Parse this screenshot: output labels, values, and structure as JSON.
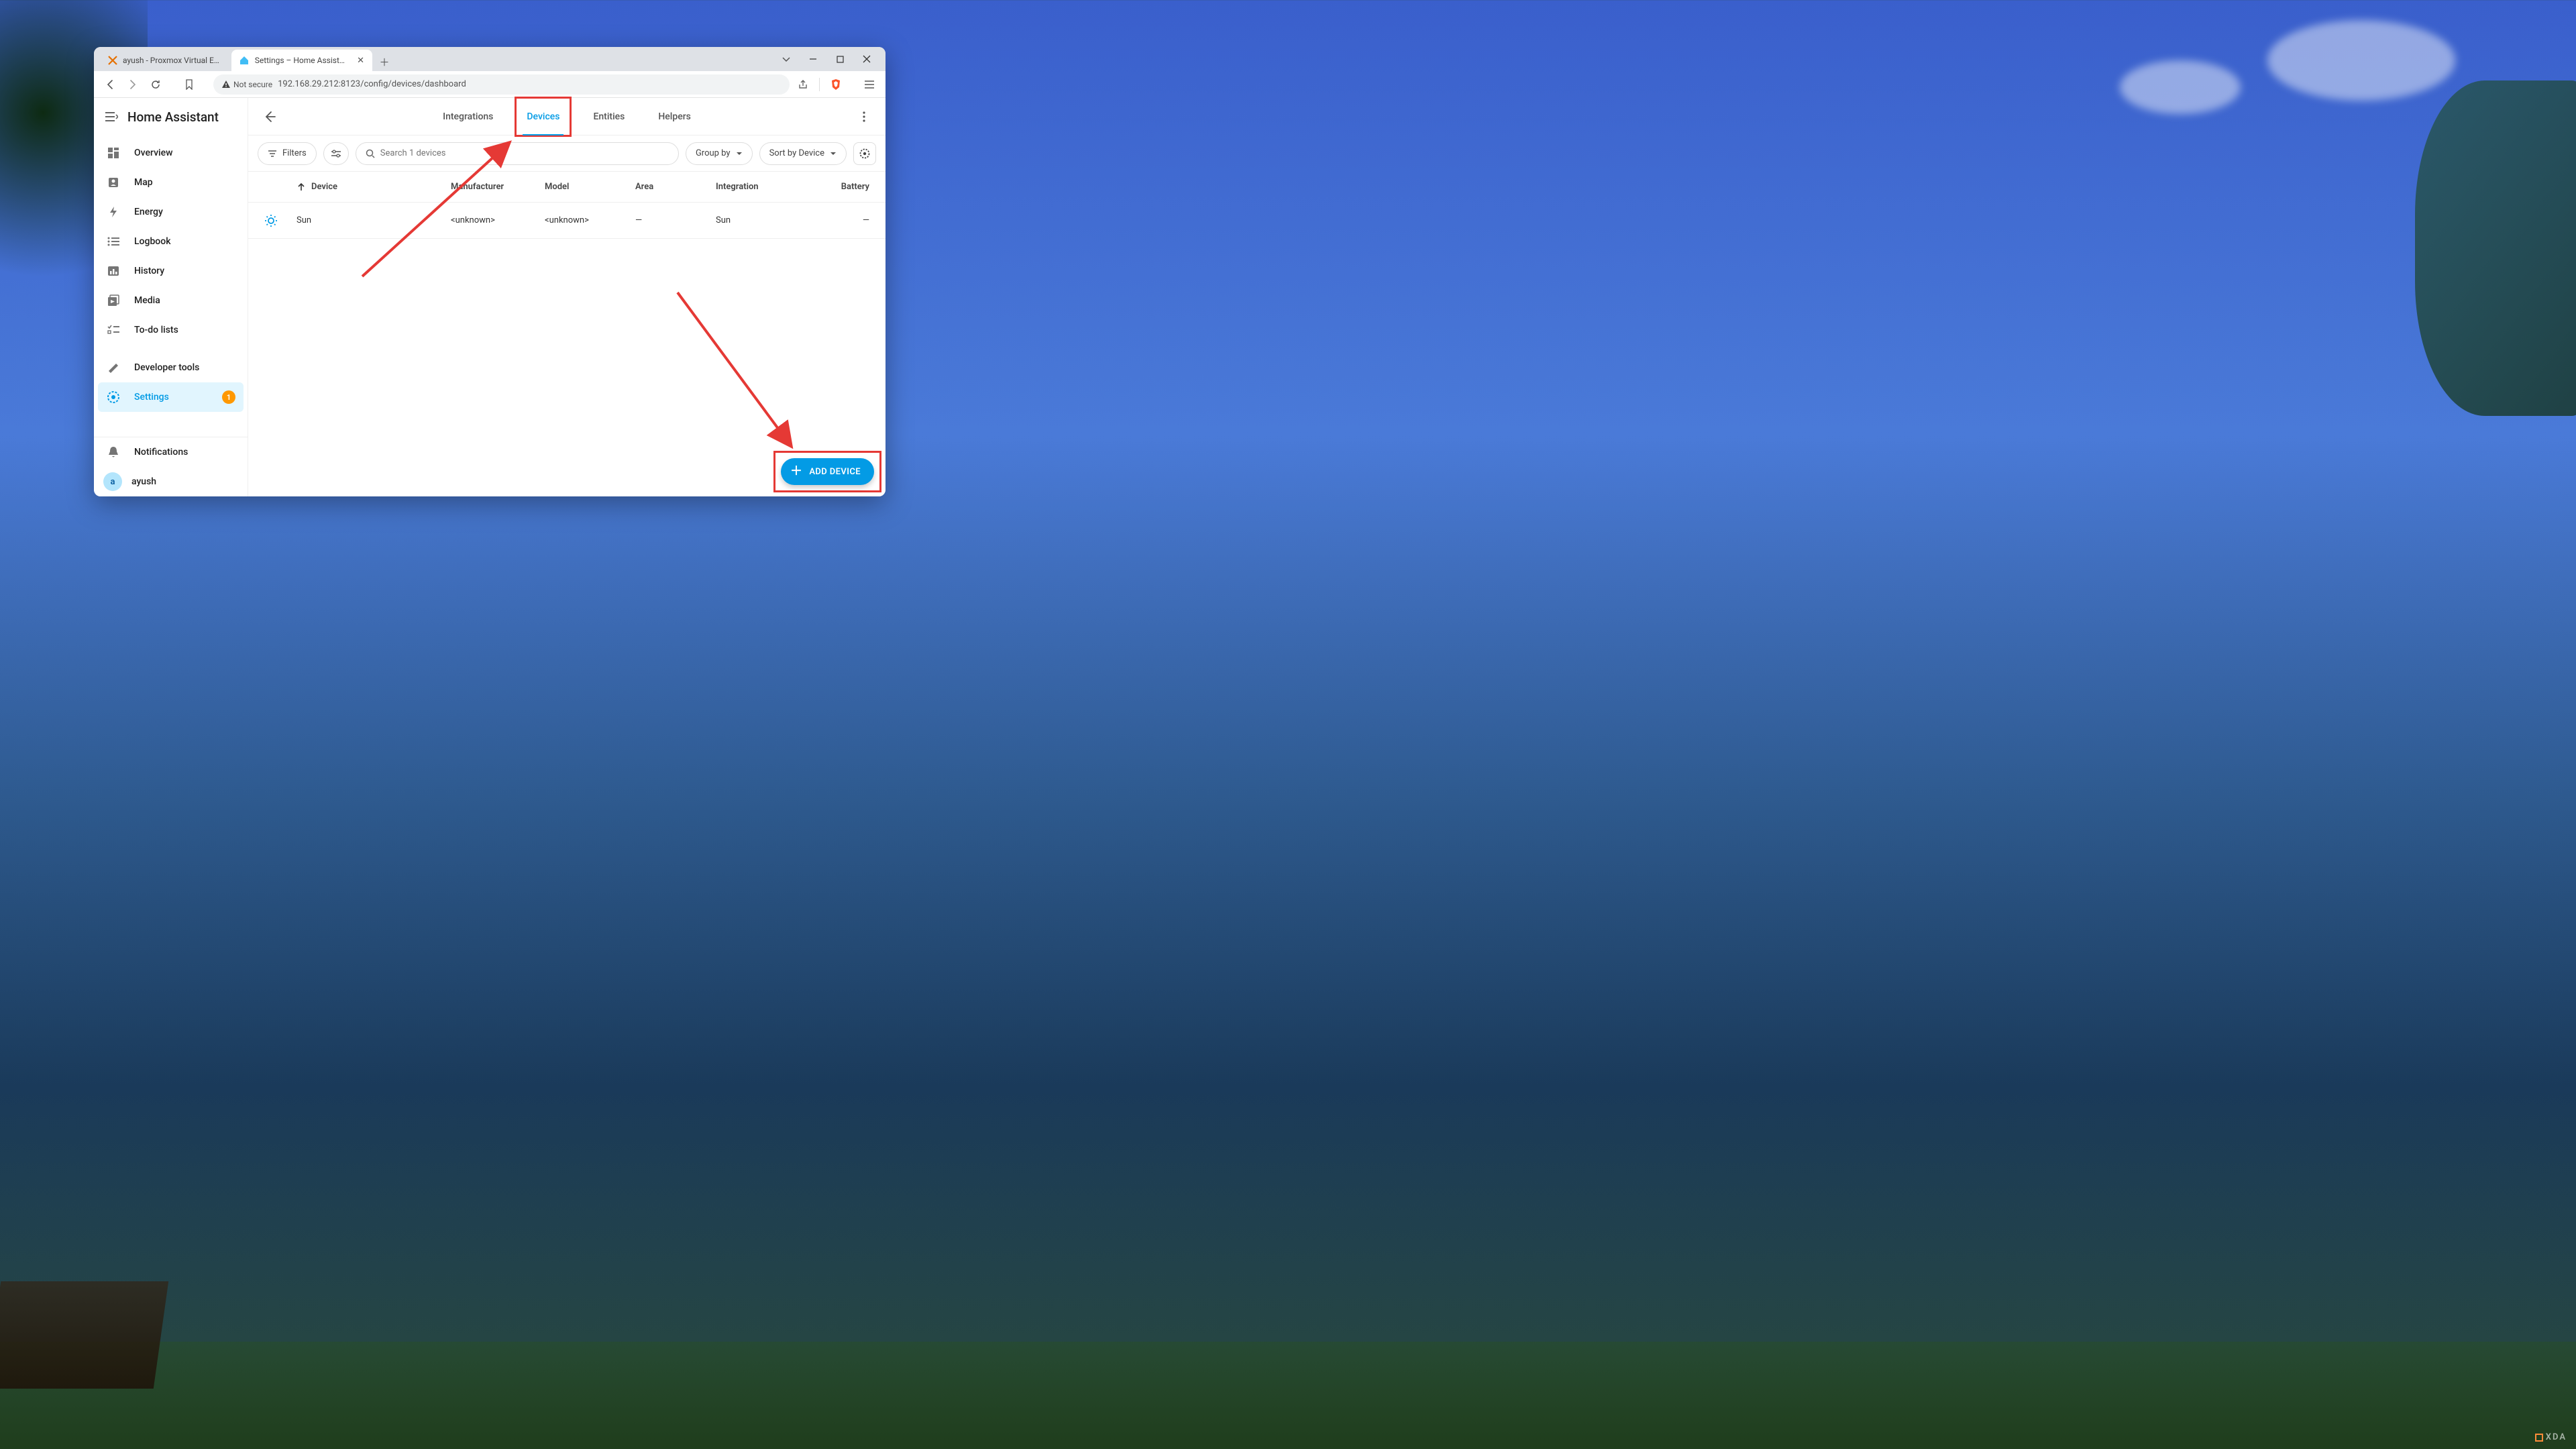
{
  "browser": {
    "tabs": [
      {
        "title": "ayush - Proxmox Virtual Environme",
        "active": false,
        "favicon": "proxmox"
      },
      {
        "title": "Settings – Home Assistant",
        "active": true,
        "favicon": "ha"
      }
    ],
    "security_label": "Not secure",
    "url": "192.168.29.212:8123/config/devices/dashboard"
  },
  "sidebar": {
    "brand": "Home Assistant",
    "items": [
      {
        "label": "Overview",
        "icon": "dashboard"
      },
      {
        "label": "Map",
        "icon": "account-box"
      },
      {
        "label": "Energy",
        "icon": "bolt"
      },
      {
        "label": "Logbook",
        "icon": "list"
      },
      {
        "label": "History",
        "icon": "chart-bar"
      },
      {
        "label": "Media",
        "icon": "library"
      },
      {
        "label": "To-do lists",
        "icon": "checklist"
      }
    ],
    "dev_tools": "Developer tools",
    "settings": "Settings",
    "settings_badge": "1",
    "notifications": "Notifications",
    "user": "ayush",
    "user_initial": "a"
  },
  "main": {
    "tabs": [
      "Integrations",
      "Devices",
      "Entities",
      "Helpers"
    ],
    "active_tab": "Devices",
    "filters_label": "Filters",
    "search_placeholder": "Search 1 devices",
    "group_by": "Group by",
    "sort_by": "Sort by Device",
    "columns": {
      "device": "Device",
      "manufacturer": "Manufacturer",
      "model": "Model",
      "area": "Area",
      "integration": "Integration",
      "battery": "Battery"
    },
    "rows": [
      {
        "name": "Sun",
        "manufacturer": "<unknown>",
        "model": "<unknown>",
        "area": "—",
        "integration": "Sun",
        "battery": "—"
      }
    ],
    "fab": "ADD DEVICE"
  },
  "watermark": "XDA"
}
